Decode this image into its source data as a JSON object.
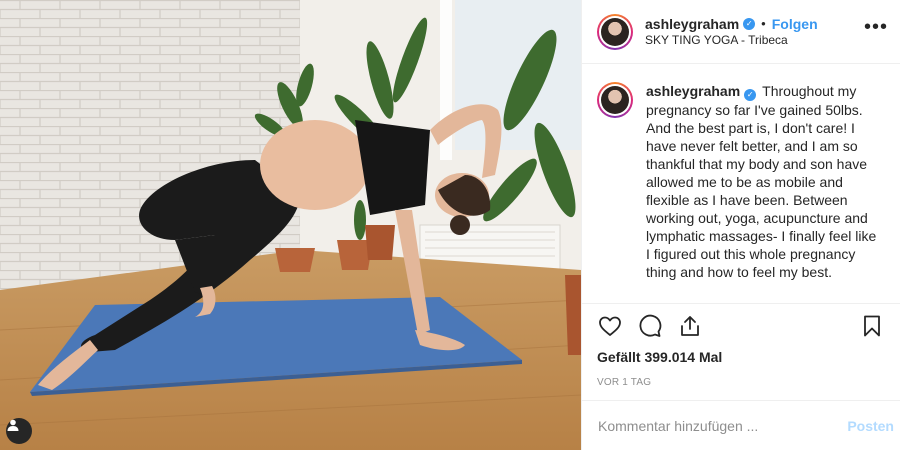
{
  "post": {
    "username": "ashleygraham",
    "follow_label": "Folgen",
    "location": "SKY TING YOGA - Tribeca",
    "more_label": "•••",
    "separator": "•",
    "caption": "Throughout my pregnancy so far I've gained 50lbs. And the best part is, I don't care! I have never felt better, and I am so thankful that my body and son have allowed me to be as mobile and flexible as I have been. Between working out, yoga, acupuncture and lymphatic massages- I finally feel like I figured out this whole pregnancy thing and how to feel my best.",
    "likes": "Gefällt 399.014 Mal",
    "timestamp": "VOR 1 TAG",
    "comment_placeholder": "Kommentar hinzufügen ...",
    "post_button": "Posten"
  },
  "colors": {
    "accent": "#3897f0",
    "post_button_disabled": "#b3dbff",
    "text": "#262626",
    "muted": "#8e8e8e"
  },
  "icons": {
    "tag": "user-tag-icon",
    "like": "heart-icon",
    "comment": "speech-bubble-icon",
    "share": "share-icon",
    "save": "bookmark-icon",
    "verified": "verified-badge-icon"
  }
}
